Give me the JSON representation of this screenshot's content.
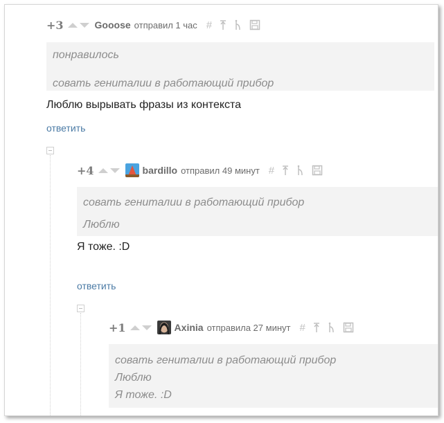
{
  "comments": [
    {
      "rating": "+3",
      "author": "Gooose",
      "sent": "отправил 1 час",
      "quote_lines": [
        "понравилось",
        "совать гениталии в работающий прибор"
      ],
      "text": "Люблю вырывать фразы из контекста",
      "reply": "ответить"
    },
    {
      "rating": "+4",
      "author": "bardillo",
      "sent": "отправил 49 минут",
      "quote_lines": [
        "совать гениталии в работающий прибор",
        "Люблю"
      ],
      "text": "Я тоже. :D",
      "reply": "ответить"
    },
    {
      "rating": "+1",
      "author": "Axinia",
      "sent": "отправила 27 минут",
      "quote_lines": [
        "совать гениталии в работающий прибор",
        "Люблю",
        "Я тоже. :D"
      ]
    }
  ],
  "icons": {
    "anchor": "hash-icon",
    "parent": "arrow-up-icon",
    "branch": "branch-icon",
    "save": "save-icon"
  },
  "colors": {
    "link": "#4a7aa5",
    "quote_bg": "#f3f3f3",
    "meta": "#7d7d7d"
  }
}
